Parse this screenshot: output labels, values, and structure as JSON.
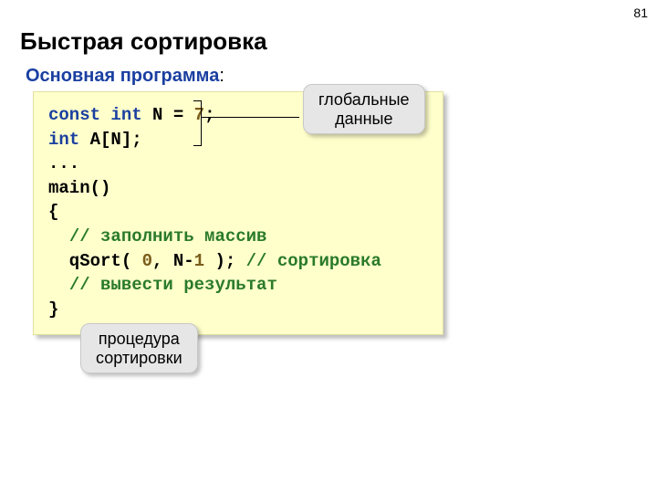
{
  "page_number": "81",
  "title": "Быстрая сортировка",
  "subtitle": "Основная программа",
  "subtitle_suffix": ":",
  "callout_top_line1": "глобальные",
  "callout_top_line2": "данные",
  "callout_bottom_line1": "процедура",
  "callout_bottom_line2": "сортировки",
  "code": {
    "l1_const": "const ",
    "l1_int": "int",
    "l1_sp": " ",
    "l1_N": "N",
    "l1_eq": " = ",
    "l1_7": "7",
    "l1_semi": ";",
    "l2_int": "int",
    "l2_rest": " A[N];",
    "l3": "...",
    "l4": "main()",
    "l5": "{",
    "l6_indent": "  ",
    "l6_comment": "// заполнить массив",
    "l7_indent": "  qSort( ",
    "l7_zero": "0",
    "l7_comma": ", N-",
    "l7_one": "1",
    "l7_close": " ); ",
    "l7_comment": "// сортировка",
    "l8_indent": "  ",
    "l8_comment": "// вывести результат",
    "l9": "}"
  }
}
